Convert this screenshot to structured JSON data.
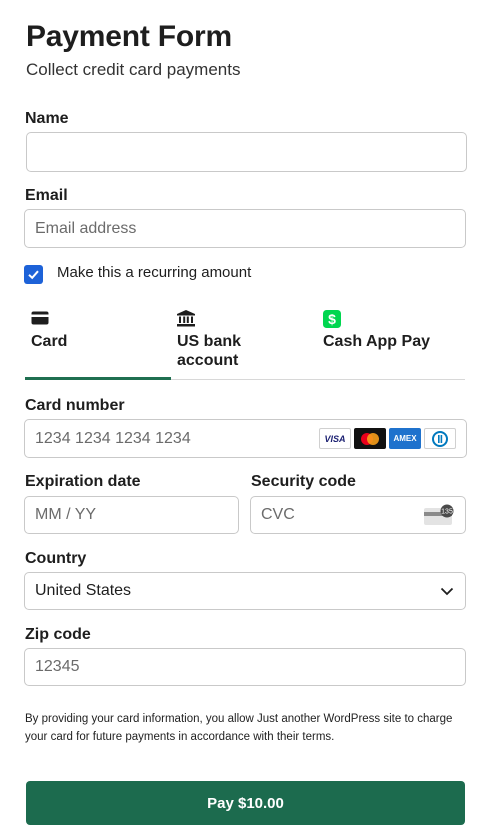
{
  "header": {
    "title": "Payment Form",
    "subtitle": "Collect credit card payments"
  },
  "name_field": {
    "label": "Name",
    "value": ""
  },
  "email_field": {
    "label": "Email",
    "placeholder": "Email address"
  },
  "recurring": {
    "label": "Make this a recurring amount",
    "checked": true
  },
  "tabs": [
    {
      "label": "Card",
      "icon": "credit-card-icon",
      "active": true
    },
    {
      "label": "US bank account",
      "icon": "bank-icon",
      "active": false
    },
    {
      "label": "Cash App Pay",
      "icon": "cash-app-icon",
      "active": false
    }
  ],
  "card_number": {
    "label": "Card number",
    "placeholder": "1234 1234 1234 1234",
    "brands": [
      "VISA",
      "Mastercard",
      "AMEX",
      "Diners"
    ]
  },
  "expiration": {
    "label": "Expiration date",
    "placeholder": "MM / YY"
  },
  "security_code": {
    "label": "Security code",
    "placeholder": "CVC",
    "hint": "135"
  },
  "country": {
    "label": "Country",
    "value": "United States"
  },
  "zip": {
    "label": "Zip code",
    "placeholder": "12345"
  },
  "notice": "By providing your card information, you allow Just another WordPress site to charge your card for future payments in accordance with their terms.",
  "pay_button": {
    "label": "Pay $10.00"
  },
  "colors": {
    "accent": "#1c6b4e",
    "checkbox": "#1d62d8",
    "cash_app": "#00d64f"
  }
}
